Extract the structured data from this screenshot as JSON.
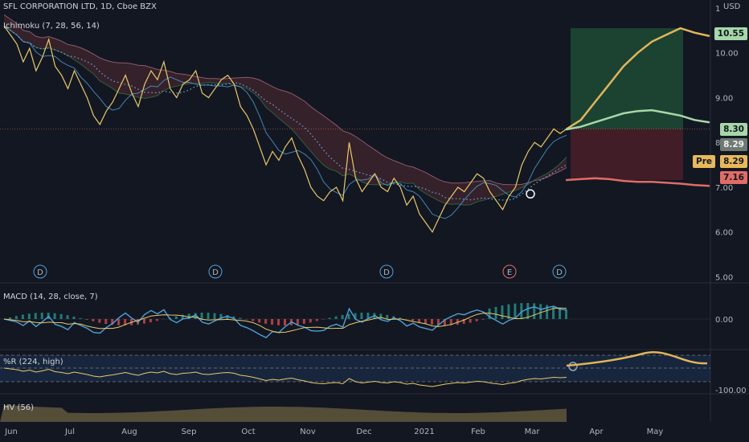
{
  "header": {
    "symbol": "SFL CORPORATION LTD, 1D, Cboe BZX",
    "ichimoku": "Ichimoku (7, 28, 56, 14)",
    "currency": "USD"
  },
  "indicators": {
    "macd": "MACD (14, 28, close, 7)",
    "wr": "%R (224, high)",
    "hv": "HV (56)"
  },
  "price_tags": {
    "upper_target": "10.55",
    "tag_830": "8.30",
    "tag_829": "8.29",
    "pre_label": "Pre",
    "pre_value": "8.29",
    "stop": "7.16"
  },
  "colors": {
    "background": "#131722",
    "price": "#e8c96a",
    "forecast": "#e0b65a",
    "tenkan": "#4ea0d8",
    "kijun": "#8a5a6a",
    "cloud_bull": "#2f5f3f",
    "cloud_bear": "#5f2f36",
    "target_zone": "#1f4a34",
    "stop_zone": "#4a1f28",
    "macd_line": "#4ea0d8",
    "signal_line": "#e8c96a",
    "green_tag": "#a6d7a9",
    "red_tag": "#e06c66",
    "yellow_tag": "#e8b95a"
  },
  "chart_data": [
    {
      "type": "line",
      "title": "SFL CORPORATION LTD, 1D, Cboe BZX",
      "x_labels": [
        "Jun",
        "Jul",
        "Aug",
        "Sep",
        "Oct",
        "Nov",
        "Dec",
        "2021",
        "Feb",
        "Mar",
        "Apr",
        "May"
      ],
      "y_ticks": [
        "1",
        "10.00",
        "9.00",
        "8.00",
        "7.00",
        "6.00",
        "5.00"
      ],
      "ylim": [
        4.9,
        11.0
      ],
      "series": [
        {
          "name": "",
          "values": [
            10.6,
            10.4,
            10.2,
            9.8,
            10.1,
            9.6,
            9.9,
            10.3,
            9.7,
            9.5,
            9.2,
            9.6,
            9.3,
            9.0,
            8.6,
            8.4,
            8.7,
            8.9,
            9.2,
            9.5,
            9.1,
            8.8,
            9.3,
            9.6,
            9.4,
            9.8,
            9.2,
            9.0,
            9.3,
            9.4,
            9.6,
            9.1,
            9.0,
            9.2,
            9.4,
            9.5,
            9.3,
            8.8,
            8.6,
            8.3,
            7.9,
            7.5,
            7.8,
            7.6,
            7.9,
            8.1,
            7.7,
            7.4,
            7.0,
            6.8,
            6.7,
            6.9,
            7.0,
            6.7,
            8.0,
            7.2,
            6.9,
            7.1,
            7.3,
            7.0,
            6.9,
            7.2,
            7.0,
            6.6,
            6.8,
            6.4,
            6.2,
            6.0,
            6.3,
            6.6,
            6.8,
            7.0,
            6.9,
            7.1,
            7.3,
            7.2,
            6.9,
            6.7,
            6.5,
            6.8,
            7.0,
            7.5,
            7.8,
            8.0,
            7.9,
            8.1,
            8.3,
            8.2,
            8.3
          ],
          "x_range": "Jun–Mar"
        },
        {
          "name": "",
          "values": [
            8.3,
            8.5,
            8.9,
            9.3,
            9.7,
            10.0,
            10.25,
            10.4,
            10.55,
            10.45,
            10.38
          ],
          "x_range": "Mar–May"
        },
        {
          "name": "",
          "values": [
            8.29,
            8.35,
            8.45,
            8.55,
            8.65,
            8.7,
            8.72,
            8.66,
            8.6,
            8.5,
            8.45
          ],
          "x_range": "Mar–May"
        },
        {
          "name": "",
          "values": [
            7.16,
            7.18,
            7.2,
            7.18,
            7.14,
            7.12,
            7.12,
            7.1,
            7.08,
            7.05,
            7.03
          ],
          "x_range": "Mar–May"
        }
      ]
    },
    {
      "type": "bar",
      "title": "MACD (14, 28, close, 7)",
      "y_ticks": [
        "0.00"
      ],
      "ylim": [
        -0.5,
        0.6
      ]
    },
    {
      "type": "line",
      "title": "%R (224, high)",
      "y_ticks": [
        "-100.00"
      ],
      "ylim": [
        -100,
        0
      ]
    },
    {
      "type": "area",
      "title": "HV (56)"
    }
  ]
}
